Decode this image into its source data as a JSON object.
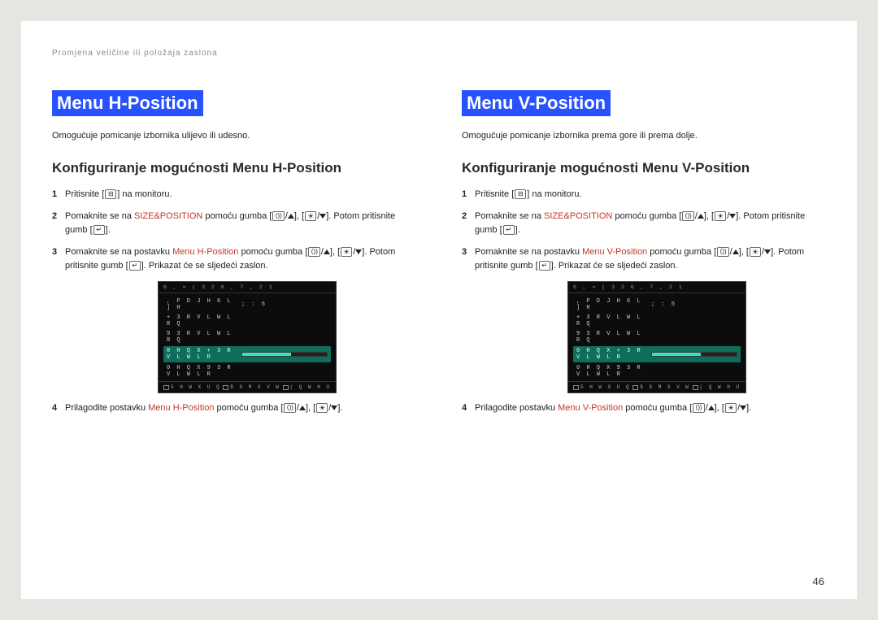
{
  "breadcrumb": "Promjena veličine ili položaja zaslona",
  "page_number": "46",
  "btn_group_html": "[<span class='icon-box'>⟨))</span>/<span class='tri-up'></span>], [<span class='icon-box sun'>☀</span>/<span class='tri-down'></span>]",
  "enter_btn_html": "[<span class='icon-box'>↵</span>]",
  "menu_btn_html": "[<span class='icon-box'>⊟</span>]",
  "left": {
    "title": "Menu H-Position",
    "desc": "Omogućuje pomicanje izbornika ulijevo ili udesno.",
    "subheading": "Konfiguriranje mogućnosti Menu H-Position",
    "step1": "Pritisnite {MENU} na monitoru.",
    "step2": "Pomaknite se na <span class='hl-red'>SIZE&POSITION</span> pomoću gumba {BTNS}. Potom pritisnite gumb {ENTER}.",
    "step3": "Pomaknite se na postavku <span class='hl-red'>Menu H-Position</span> pomoću gumba {BTNS}. Potom pritisnite gumb {ENTER}. Prikazat će se sljedeći zaslon.",
    "step4": "Prilagodite postavku <span class='hl-red'>Menu H-Position</span> pomoću gumba {BTNS}."
  },
  "right": {
    "title": "Menu V-Position",
    "desc": "Omogućuje pomicanje izbornika prema gore ili prema dolje.",
    "subheading": "Konfiguriranje mogućnosti Menu V-Position",
    "step1": "Pritisnite {MENU} na monitoru.",
    "step2": "Pomaknite se na <span class='hl-red'>SIZE&POSITION</span> pomoću gumba {BTNS}. Potom pritisnite gumb {ENTER}.",
    "step3": "Pomaknite se na postavku <span class='hl-red'>Menu V-Position</span> pomoću gumba {BTNS}. Potom pritisnite gumb {ENTER}.  Prikazat će se sljedeći zaslon.",
    "step4": "Prilagodite postavku <span class='hl-red'>Menu V-Position</span> pomoću gumba {BTNS}."
  },
  "osd": {
    "header": "6 , = ( \t 3 2 6 , 7 , 2 1",
    "rows": [
      ", P D J H  6 L ] H",
      "+  3 R V L W L R Q",
      "9  3 R V L W L R Q",
      "0 H Q X  +  3 R V L W L R",
      "0 H Q X  9  3 R V L W L R"
    ],
    "row_right": "\t ; : 5",
    "slider_pct": 58,
    "footer": {
      "l": "5 H W X U Q",
      "m": "$ G M X V W",
      "r": "( Q W H U"
    }
  }
}
